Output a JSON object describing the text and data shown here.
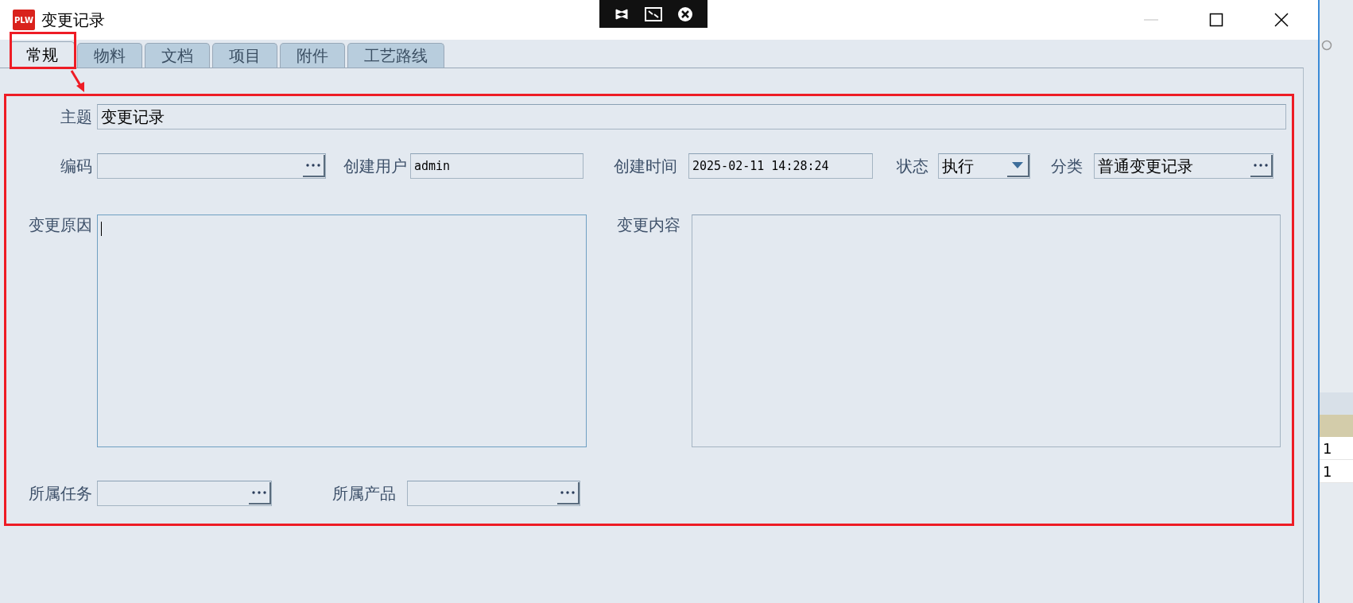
{
  "window": {
    "title": "变更记录",
    "logo_text": "PLW",
    "minimize_disabled": true
  },
  "tabs": [
    {
      "label": "常规",
      "selected": true
    },
    {
      "label": "物料",
      "selected": false
    },
    {
      "label": "文档",
      "selected": false
    },
    {
      "label": "项目",
      "selected": false
    },
    {
      "label": "附件",
      "selected": false
    },
    {
      "label": "工艺路线",
      "selected": false
    }
  ],
  "form": {
    "subject": {
      "label": "主题",
      "value": "变更记录"
    },
    "info_fields": [
      {
        "kind": "lookup",
        "label": "编码"
      },
      {
        "kind": "text",
        "label": "创建用户",
        "value": "admin"
      },
      {
        "kind": "text",
        "label": "创建时间",
        "value": "2025-02-11 14:28:24"
      },
      {
        "kind": "dropdown",
        "label": "状态",
        "value": "执行"
      },
      {
        "kind": "lookup",
        "label": "分类",
        "value": "普通变更记录"
      }
    ],
    "text_areas": [
      {
        "label": "变更原因",
        "focused": true
      },
      {
        "label": "变更内容",
        "focused": false
      }
    ],
    "link_fields": [
      {
        "label": "所属任务"
      },
      {
        "label": "所属产品"
      }
    ]
  },
  "background_window": {
    "rows": [
      "1",
      "1"
    ]
  }
}
